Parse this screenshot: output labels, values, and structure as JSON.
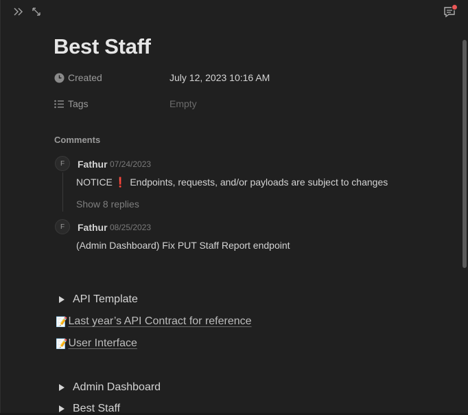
{
  "page": {
    "title": "Best Staff"
  },
  "properties": [
    {
      "name": "Created",
      "icon": "clock-icon",
      "value": "July 12, 2023 10:16 AM",
      "empty": false
    },
    {
      "name": "Tags",
      "icon": "list-icon",
      "value": "Empty",
      "empty": true
    }
  ],
  "comments": {
    "heading": "Comments",
    "items": [
      {
        "avatar": "F",
        "author": "Fathur",
        "date": "07/24/2023",
        "prefix": "NOTICE",
        "mark": "❗",
        "text": "Endpoints, requests, and/or payloads are subject to changes",
        "replies_label": "Show 8 replies"
      },
      {
        "avatar": "F",
        "author": "Fathur",
        "date": "08/25/2023",
        "text": "(Admin Dashboard) Fix PUT Staff Report endpoint"
      }
    ]
  },
  "blocks": {
    "toggle_api_template": "API Template",
    "link_api_contract": {
      "emoji": "📝",
      "label": "Last year’s API Contract for reference"
    },
    "link_user_interface": {
      "emoji": "📝",
      "label": "User Interface"
    },
    "toggle_admin_dashboard": "Admin Dashboard",
    "toggle_best_staff": "Best Staff"
  },
  "colors": {
    "background": "#202020",
    "notification": "#eb5757",
    "exclamation": "#e03e3e"
  }
}
